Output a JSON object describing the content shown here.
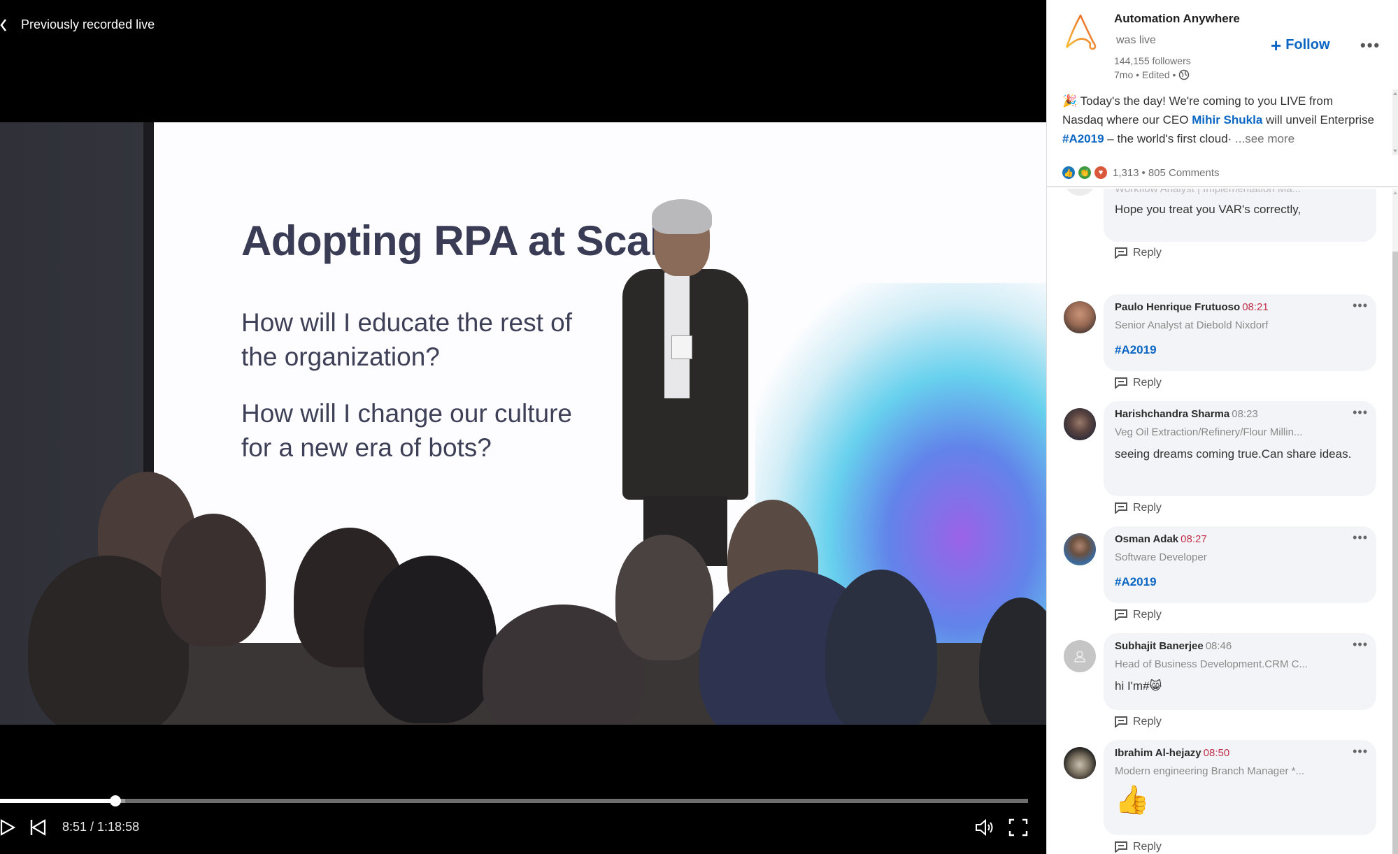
{
  "video": {
    "header_title": "Previously recorded live",
    "slide": {
      "title": "Adopting RPA at Scal",
      "question_1": "How will I educate the rest of the organization?",
      "question_2": "How will I change our culture for a new era of bots?"
    },
    "time_display": "8:51 / 1:18:58",
    "current_time": "8:51",
    "duration": "1:18:58",
    "progress_played_percent": 11.2,
    "progress_buffered_percent": 12.2
  },
  "post": {
    "author": "Automation Anywhere",
    "status": "was live",
    "followers": "144,155 followers",
    "meta": "7mo • Edited •",
    "follow_label": "Follow",
    "more_label": "•••",
    "text_part_1": " Today's the day! We're coming to you LIVE from Nasdaq where our CEO ",
    "mention": "Mihir Shukla",
    "text_part_2": " will unveil Enterprise ",
    "hashtag": "#A2019",
    "text_part_3": " – the world's first cloud·  ",
    "see_more": "...see more",
    "reaction_count": "1,313",
    "separator": "•",
    "comment_count": "805 Comments",
    "brand_color": "#0a66c2"
  },
  "comments": [
    {
      "name": "",
      "time": "",
      "title": "Workflow Analyst | Implementation Ma...",
      "body": "Hope you treat you VAR's correctly,",
      "reply_label": "Reply"
    },
    {
      "name": "Paulo Henrique Frutuoso",
      "time": "08:21",
      "title": "Senior Analyst at Diebold Nixdorf",
      "body": "#A2019",
      "reply_label": "Reply"
    },
    {
      "name": "Harishchandra Sharma",
      "time": "08:23",
      "title": "Veg Oil Extraction/Refinery/Flour Millin...",
      "body": "seeing dreams coming true.Can share ideas.",
      "reply_label": "Reply"
    },
    {
      "name": "Osman Adak",
      "time": "08:27",
      "title": "Software Developer",
      "body": "#A2019",
      "reply_label": "Reply"
    },
    {
      "name": "Subhajit Banerjee",
      "time": "08:46",
      "title": "Head of Business Development.CRM C...",
      "body": "hi I'm#😸",
      "reply_label": "Reply"
    },
    {
      "name": "Ibrahim Al-hejazy",
      "time": "08:50",
      "title": "Modern engineering Branch Manager *...",
      "body": "👍",
      "reply_label": "Reply"
    }
  ],
  "comment_more_label": "•••"
}
